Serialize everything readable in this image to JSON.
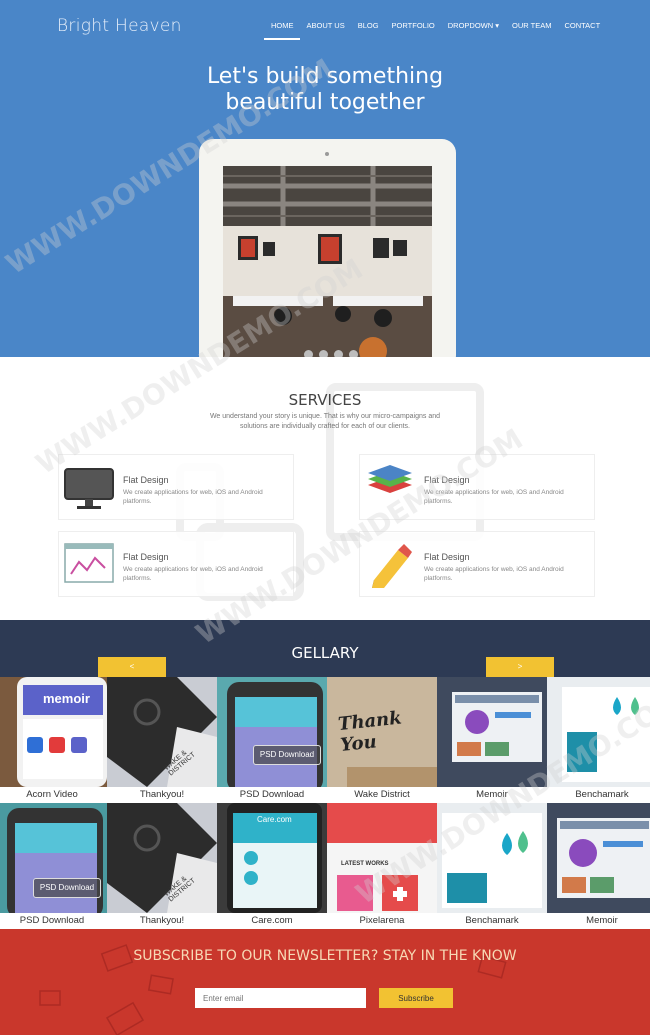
{
  "brand": "Bright Heaven",
  "nav": [
    "HOME",
    "ABOUT US",
    "BLOG",
    "PORTFOLIO",
    "DROPDOWN ▾",
    "OUR TEAM",
    "CONTACT"
  ],
  "hero": {
    "line1": "Let's build something",
    "line2": "beautiful together"
  },
  "services": {
    "title": "SERVICES",
    "description": "We understand your story is unique. That is why our micro-campaigns and solutions are individually crafted for each of our clients.",
    "cards": [
      {
        "icon": "monitor-icon",
        "title": "Flat Design",
        "text": "We create applications for web, iOS and Android platforms."
      },
      {
        "icon": "layers-icon",
        "title": "Flat Design",
        "text": "We create applications for web, iOS and Android platforms."
      },
      {
        "icon": "chart-icon",
        "title": "Flat Design",
        "text": "We create applications for web, iOS and Android platforms."
      },
      {
        "icon": "pencil-icon",
        "title": "Flat Design",
        "text": "We create applications for web, iOS and Android platforms."
      }
    ]
  },
  "gallery": {
    "title": "GELLARY",
    "prev": "<",
    "next": ">",
    "row1": [
      "Acorn Video",
      "Thankyou!",
      "PSD Download",
      "Wake District",
      "Memoir",
      "Benchamark"
    ],
    "row2": [
      "PSD Download",
      "Thankyou!",
      "Care.com",
      "Pixelarena",
      "Benchamark",
      "Memoir"
    ],
    "tile_text": {
      "memoir": "memoir",
      "psd": "PSD Download",
      "wake": "WAKE & DISTRICT",
      "care": "Care.com",
      "latest": "LATEST WORKS",
      "thanks": "Thank You"
    }
  },
  "newsletter": {
    "title": "SUBSCRIBE TO OUR NEWSLETTER? STAY IN THE KNOW",
    "placeholder": "Enter email",
    "button": "Subscribe"
  },
  "watermark": "WWW.DOWNDEMO.COM",
  "colors": {
    "hero": "#4a86c8",
    "gallery": "#2d3a54",
    "newsletter": "#c9372c",
    "accent": "#f2c232"
  }
}
